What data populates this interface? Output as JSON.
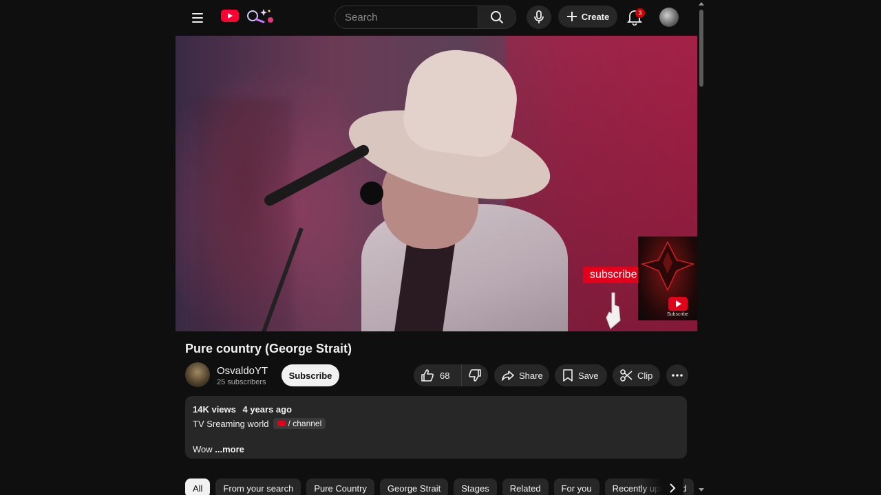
{
  "header": {
    "search_placeholder": "Search",
    "create_label": "Create",
    "notification_count": "3"
  },
  "video": {
    "overlay_subscribe_text": "subscribe",
    "overlay_logo_caption": "Subscribe",
    "title": "Pure country (George Strait)"
  },
  "channel": {
    "name": "OsvaldoYT",
    "subscribers": "25 subscribers",
    "subscribe_label": "Subscribe"
  },
  "actions": {
    "like_count": "68",
    "share_label": "Share",
    "save_label": "Save",
    "clip_label": "Clip"
  },
  "description": {
    "views": "14K views",
    "age": "4 years ago",
    "line_text": "TV Sreaming world",
    "channel_tag": "/ channel",
    "body": "Wow",
    "more_label": "...more"
  },
  "chips": [
    {
      "label": "All",
      "active": true
    },
    {
      "label": "From your search"
    },
    {
      "label": "Pure Country"
    },
    {
      "label": "George Strait"
    },
    {
      "label": "Stages"
    },
    {
      "label": "Related"
    },
    {
      "label": "For you"
    },
    {
      "label": "Recently uploaded"
    }
  ],
  "colors": {
    "background": "#0f0f0f",
    "surface": "#272727",
    "brand_red": "#ff0033",
    "text": "#f1f1f1",
    "secondary_text": "#aaaaaa"
  }
}
